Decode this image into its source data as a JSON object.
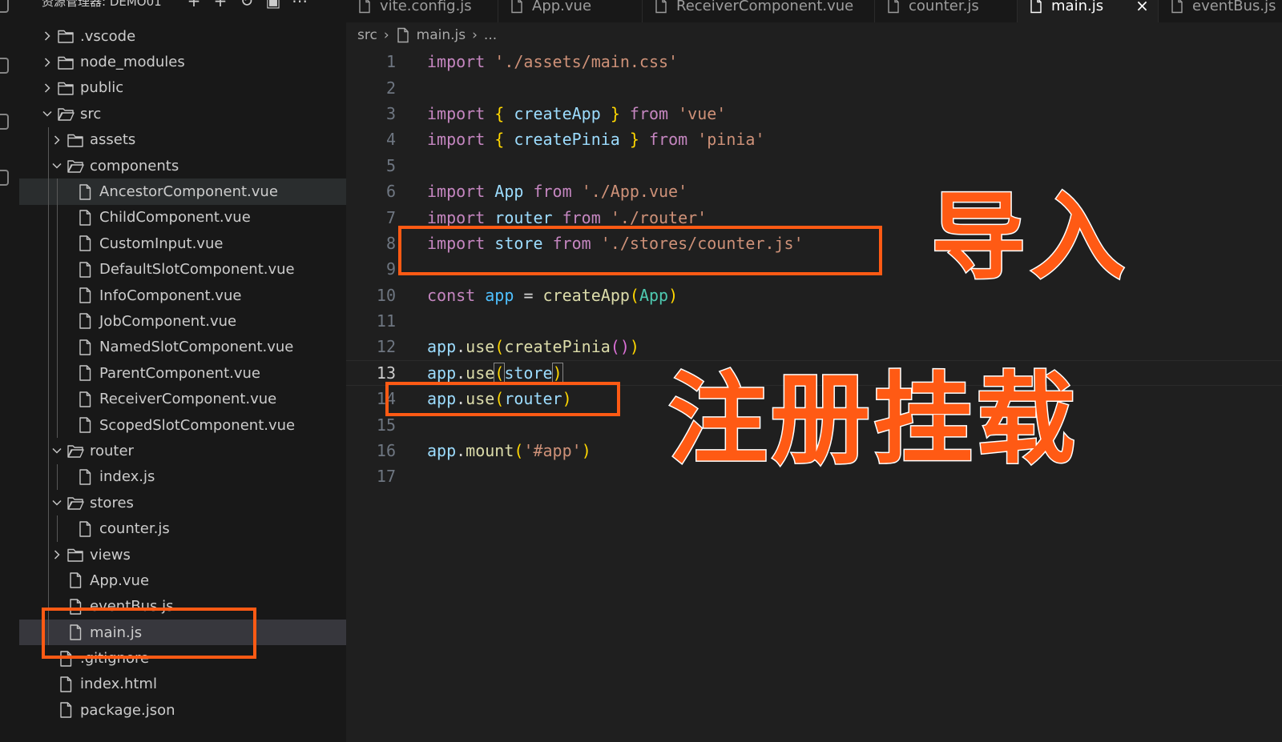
{
  "explorer": {
    "header": "资源管理器: DEMO01",
    "actions": [
      "new-file-icon",
      "new-folder-icon",
      "refresh-icon",
      "collapse-all-icon",
      "more-actions-icon"
    ],
    "items": [
      {
        "label": ".vscode",
        "type": "folder",
        "expanded": false,
        "depth": 0
      },
      {
        "label": "node_modules",
        "type": "folder",
        "expanded": false,
        "depth": 0
      },
      {
        "label": "public",
        "type": "folder",
        "expanded": false,
        "depth": 0
      },
      {
        "label": "src",
        "type": "folder",
        "expanded": true,
        "depth": 0
      },
      {
        "label": "assets",
        "type": "folder",
        "expanded": false,
        "depth": 1
      },
      {
        "label": "components",
        "type": "folder",
        "expanded": true,
        "depth": 1
      },
      {
        "label": "AncestorComponent.vue",
        "type": "file",
        "depth": 2,
        "state": "hover"
      },
      {
        "label": "ChildComponent.vue",
        "type": "file",
        "depth": 2
      },
      {
        "label": "CustomInput.vue",
        "type": "file",
        "depth": 2
      },
      {
        "label": "DefaultSlotComponent.vue",
        "type": "file",
        "depth": 2
      },
      {
        "label": "InfoComponent.vue",
        "type": "file",
        "depth": 2
      },
      {
        "label": "JobComponent.vue",
        "type": "file",
        "depth": 2
      },
      {
        "label": "NamedSlotComponent.vue",
        "type": "file",
        "depth": 2
      },
      {
        "label": "ParentComponent.vue",
        "type": "file",
        "depth": 2
      },
      {
        "label": "ReceiverComponent.vue",
        "type": "file",
        "depth": 2
      },
      {
        "label": "ScopedSlotComponent.vue",
        "type": "file",
        "depth": 2
      },
      {
        "label": "router",
        "type": "folder",
        "expanded": true,
        "depth": 1
      },
      {
        "label": "index.js",
        "type": "file",
        "depth": 2
      },
      {
        "label": "stores",
        "type": "folder",
        "expanded": true,
        "depth": 1
      },
      {
        "label": "counter.js",
        "type": "file",
        "depth": 2
      },
      {
        "label": "views",
        "type": "folder",
        "expanded": false,
        "depth": 1
      },
      {
        "label": "App.vue",
        "type": "file",
        "depth": 1
      },
      {
        "label": "eventBus.js",
        "type": "file",
        "depth": 1
      },
      {
        "label": "main.js",
        "type": "file",
        "depth": 1,
        "state": "selected"
      },
      {
        "label": ".gitignore",
        "type": "file",
        "depth": 0
      },
      {
        "label": "index.html",
        "type": "file",
        "depth": 0
      },
      {
        "label": "package.json",
        "type": "file",
        "depth": 0
      }
    ]
  },
  "tabs": [
    {
      "label": "vite.config.js",
      "active": false
    },
    {
      "label": "App.vue",
      "active": false
    },
    {
      "label": "ReceiverComponent.vue",
      "active": false
    },
    {
      "label": "counter.js",
      "active": false
    },
    {
      "label": "main.js",
      "active": true,
      "close": "×"
    },
    {
      "label": "eventBus.js",
      "active": false
    }
  ],
  "breadcrumb": {
    "folder": "src",
    "file": "main.js",
    "more": "..."
  },
  "editor": {
    "current_line": 13,
    "lines": [
      {
        "n": "1",
        "tokens": [
          [
            "import",
            "k"
          ],
          [
            " ",
            "plain"
          ],
          [
            "'./assets/main.css'",
            "s"
          ]
        ]
      },
      {
        "n": "2",
        "tokens": []
      },
      {
        "n": "3",
        "tokens": [
          [
            "import",
            "k"
          ],
          [
            " ",
            "plain"
          ],
          [
            "{",
            "p1"
          ],
          [
            " ",
            "plain"
          ],
          [
            "createApp",
            "b"
          ],
          [
            " ",
            "plain"
          ],
          [
            "}",
            "p1"
          ],
          [
            " ",
            "plain"
          ],
          [
            "from",
            "k"
          ],
          [
            " ",
            "plain"
          ],
          [
            "'vue'",
            "s"
          ]
        ]
      },
      {
        "n": "4",
        "tokens": [
          [
            "import",
            "k"
          ],
          [
            " ",
            "plain"
          ],
          [
            "{",
            "p1"
          ],
          [
            " ",
            "plain"
          ],
          [
            "createPinia",
            "b"
          ],
          [
            " ",
            "plain"
          ],
          [
            "}",
            "p1"
          ],
          [
            " ",
            "plain"
          ],
          [
            "from",
            "k"
          ],
          [
            " ",
            "plain"
          ],
          [
            "'pinia'",
            "s"
          ]
        ]
      },
      {
        "n": "5",
        "tokens": []
      },
      {
        "n": "6",
        "tokens": [
          [
            "import",
            "k"
          ],
          [
            " ",
            "plain"
          ],
          [
            "App",
            "b"
          ],
          [
            " ",
            "plain"
          ],
          [
            "from",
            "k"
          ],
          [
            " ",
            "plain"
          ],
          [
            "'./App.vue'",
            "s"
          ]
        ]
      },
      {
        "n": "7",
        "tokens": [
          [
            "import",
            "k"
          ],
          [
            " ",
            "plain"
          ],
          [
            "router",
            "b"
          ],
          [
            " ",
            "plain"
          ],
          [
            "from",
            "k"
          ],
          [
            " ",
            "plain"
          ],
          [
            "'./router'",
            "s"
          ]
        ]
      },
      {
        "n": "8",
        "tokens": [
          [
            "import",
            "k"
          ],
          [
            " ",
            "plain"
          ],
          [
            "store",
            "b"
          ],
          [
            " ",
            "plain"
          ],
          [
            "from",
            "k"
          ],
          [
            " ",
            "plain"
          ],
          [
            "'./stores/counter.js'",
            "s"
          ]
        ]
      },
      {
        "n": "9",
        "tokens": []
      },
      {
        "n": "10",
        "tokens": [
          [
            "const",
            "k"
          ],
          [
            " ",
            "plain"
          ],
          [
            "app",
            "v"
          ],
          [
            " ",
            "plain"
          ],
          [
            "=",
            "plain"
          ],
          [
            " ",
            "plain"
          ],
          [
            "createApp",
            "f"
          ],
          [
            "(",
            "p1"
          ],
          [
            "App",
            "cls"
          ],
          [
            ")",
            "p1"
          ]
        ]
      },
      {
        "n": "11",
        "tokens": []
      },
      {
        "n": "12",
        "tokens": [
          [
            "app",
            "b"
          ],
          [
            ".",
            "plain"
          ],
          [
            "use",
            "f"
          ],
          [
            "(",
            "p1"
          ],
          [
            "createPinia",
            "f"
          ],
          [
            "(",
            "p2"
          ],
          [
            ")",
            "p2"
          ],
          [
            ")",
            "p1"
          ]
        ]
      },
      {
        "n": "13",
        "tokens": [
          [
            "app",
            "b"
          ],
          [
            ".",
            "plain"
          ],
          [
            "use",
            "f"
          ],
          [
            "(",
            "p1"
          ],
          [
            "store",
            "b"
          ],
          [
            ")",
            "p1"
          ]
        ]
      },
      {
        "n": "14",
        "tokens": [
          [
            "app",
            "b"
          ],
          [
            ".",
            "plain"
          ],
          [
            "use",
            "f"
          ],
          [
            "(",
            "p1"
          ],
          [
            "router",
            "b"
          ],
          [
            ")",
            "p1"
          ]
        ]
      },
      {
        "n": "15",
        "tokens": []
      },
      {
        "n": "16",
        "tokens": [
          [
            "app",
            "b"
          ],
          [
            ".",
            "plain"
          ],
          [
            "mount",
            "f"
          ],
          [
            "(",
            "p1"
          ],
          [
            "'#app'",
            "s"
          ],
          [
            ")",
            "p1"
          ]
        ]
      },
      {
        "n": "17",
        "tokens": []
      }
    ]
  },
  "annotations": {
    "import_label": "导入",
    "register_label": "注册挂载",
    "color": "#ff5a14"
  }
}
